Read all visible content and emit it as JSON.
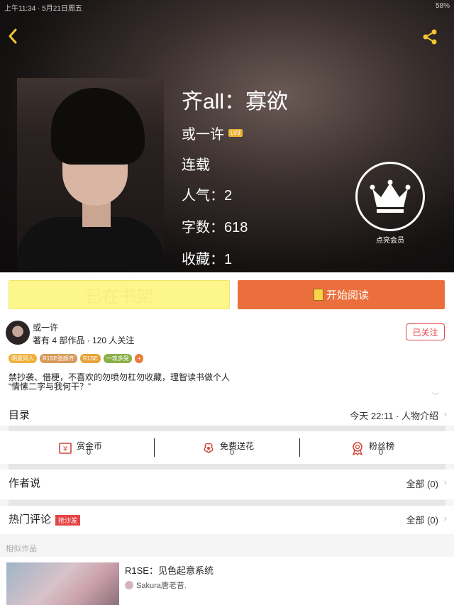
{
  "status_bar": {
    "left": "上午11:34 · 5月21日周五",
    "right": "58%"
  },
  "book": {
    "title": "齐all：寡欲",
    "author": "或一许",
    "level": "LV3",
    "status": "连载",
    "popularity": "人气：2",
    "word_count": "字数：618",
    "favorites": "收藏：1"
  },
  "vip": {
    "label": "点亮会员"
  },
  "actions": {
    "shelf_label": "已在书架",
    "read_label": "开始阅读"
  },
  "author_section": {
    "name": "或一许",
    "stats": "著有 4 部作品 · 120 人关注",
    "follow_label": "已关注",
    "tags": [
      {
        "label": "明星同人",
        "color": "#eeb23c"
      },
      {
        "label": "R1SE张颜齐",
        "color": "#d89a5a"
      },
      {
        "label": "R1SE",
        "color": "#e8a33b"
      },
      {
        "label": "一攻多受",
        "color": "#8bb04a"
      },
      {
        "label": "+",
        "color": "#ef7b3a"
      }
    ],
    "intro_line1": "禁抄袭、借梗，不喜欢的勿喷勿杠勿收藏，理智读书做个人",
    "intro_line2": "“情愫二字与我何干？”",
    "expand_icon": "chevron-down-icon"
  },
  "catalog": {
    "title": "目录",
    "update": "今天 22:11 · 人物介绍"
  },
  "gifts": [
    {
      "label": "赏金币",
      "count": "0",
      "icon": "coin-icon"
    },
    {
      "label": "免费送花",
      "count": "0",
      "icon": "flower-icon"
    },
    {
      "label": "粉丝榜",
      "count": "0",
      "icon": "medal-icon"
    }
  ],
  "author_says": {
    "title": "作者说",
    "right": "全部 (0)"
  },
  "hot_comments": {
    "title": "热门评论",
    "badge": "抢沙发",
    "right": "全部 (0)"
  },
  "similar": {
    "label": "相似作品",
    "items": [
      {
        "title": "R1SE：见色起意系统",
        "author": "Sakura唐老昔."
      }
    ]
  },
  "colors": {
    "accent": "#eb6f3c",
    "shelf_yellow": "#fdf68b",
    "red": "#e54545"
  }
}
